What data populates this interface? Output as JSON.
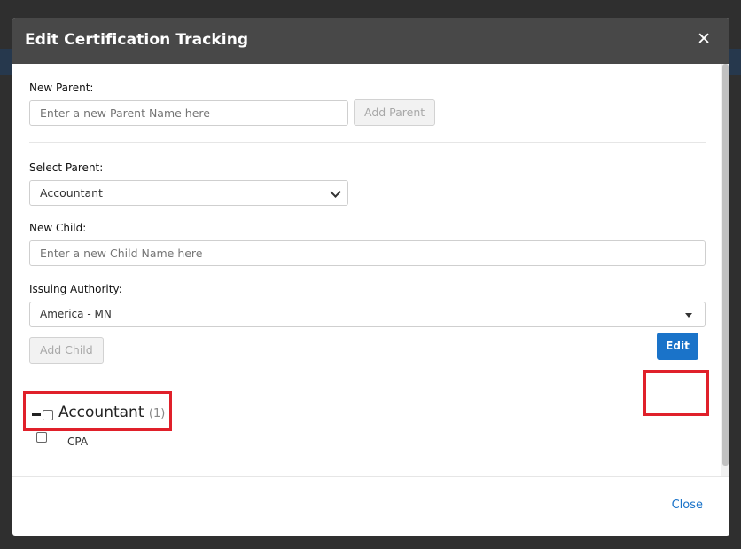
{
  "modal": {
    "title": "Edit Certification Tracking",
    "close_icon": "close-icon"
  },
  "form": {
    "new_parent_label": "New Parent:",
    "new_parent_placeholder": "Enter a new Parent Name here",
    "add_parent_label": "Add Parent",
    "select_parent_label": "Select Parent:",
    "select_parent_value": "Accountant",
    "new_child_label": "New Child:",
    "new_child_placeholder": "Enter a new Child Name here",
    "issuing_authority_label": "Issuing Authority:",
    "issuing_authority_value": "America - MN",
    "add_child_label": "Add Child"
  },
  "tree": {
    "parent_name": "Accountant",
    "parent_count": "(1)",
    "edit_label": "Edit",
    "children": [
      {
        "label": "CPA"
      }
    ]
  },
  "footer": {
    "close_label": "Close"
  },
  "colors": {
    "header_bg": "#484848",
    "primary": "#1a73c9",
    "highlight": "#e0202a"
  }
}
